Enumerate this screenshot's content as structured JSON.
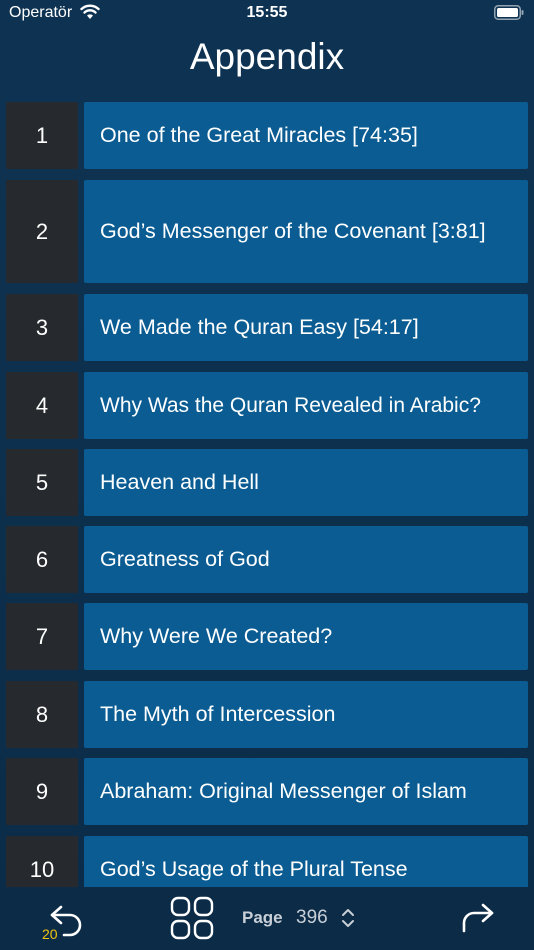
{
  "status": {
    "carrier": "Operatör",
    "time": "15:55"
  },
  "header": {
    "title": "Appendix"
  },
  "appendix": {
    "items": [
      {
        "number": "1",
        "title": "One of the Great Miracles [74:35]"
      },
      {
        "number": "2",
        "title": "God’s Messenger of the Covenant [3:81]"
      },
      {
        "number": "3",
        "title": "We Made the Quran Easy [54:17]"
      },
      {
        "number": "4",
        "title": "Why Was the Quran Revealed in Arabic?"
      },
      {
        "number": "5",
        "title": "Heaven and Hell"
      },
      {
        "number": "6",
        "title": "Greatness of God"
      },
      {
        "number": "7",
        "title": "Why Were We Created?"
      },
      {
        "number": "8",
        "title": "The Myth of Intercession"
      },
      {
        "number": "9",
        "title": "Abraham: Original Messenger of Islam"
      },
      {
        "number": "10",
        "title": "God’s Usage of the Plural Tense"
      }
    ]
  },
  "toolbar": {
    "back_icon": "undo-arrow-icon",
    "back_count": "20",
    "grid_icon": "grid-icon",
    "page_label": "Page",
    "page_number": "396",
    "stepper_icon": "chevron-up-down-icon",
    "forward_icon": "redo-arrow-icon"
  },
  "colors": {
    "background": "#0e3352",
    "number_cell": "#262a2e",
    "title_cell": "#0a5c92",
    "badge": "#f1c40f"
  }
}
